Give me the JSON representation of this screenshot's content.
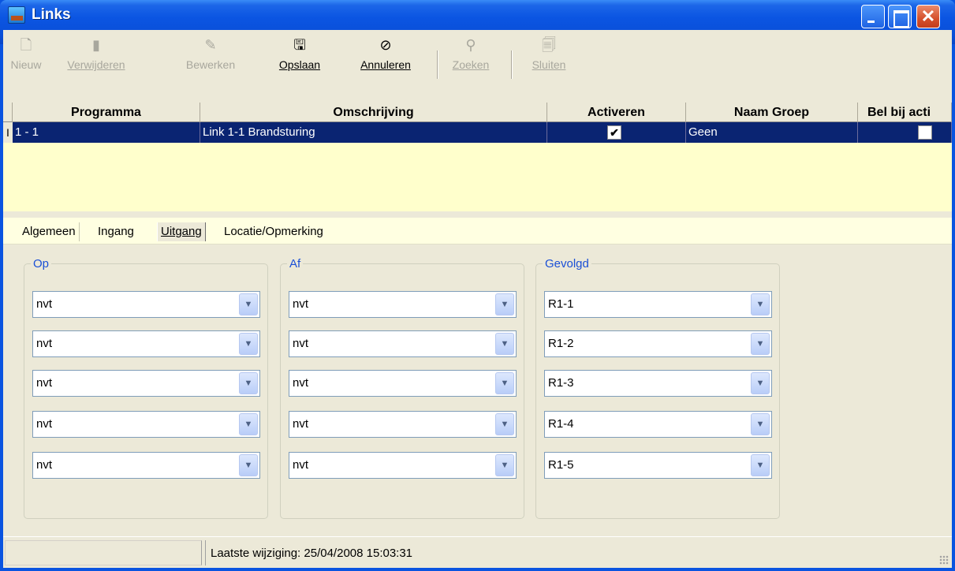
{
  "window": {
    "title": "Links"
  },
  "toolbar": {
    "buttons": [
      {
        "label": "Nieuw",
        "icon": "document-icon",
        "enabled": false
      },
      {
        "label": "Verwijderen",
        "icon": "trash-icon",
        "enabled": false
      },
      {
        "label": "Bewerken",
        "icon": "edit-icon",
        "enabled": false
      },
      {
        "label": "Opslaan",
        "icon": "save-icon",
        "enabled": true
      },
      {
        "label": "Annuleren",
        "icon": "cancel-icon",
        "enabled": true
      },
      {
        "label": "Zoeken",
        "icon": "search-icon",
        "enabled": false
      },
      {
        "label": "Sluiten",
        "icon": "close-doc-icon",
        "enabled": false
      }
    ]
  },
  "grid": {
    "columns": [
      "Programma",
      "Omschrijving",
      "Activeren",
      "Naam Groep",
      "Bel bij acti"
    ],
    "rows": [
      {
        "programma": "1 - 1",
        "omschrijving": "Link 1-1 Brandsturing",
        "activeren": true,
        "naam_groep": "Geen",
        "bel_bij_activatie": false
      }
    ],
    "row_indicator": "I"
  },
  "tabs": [
    "Algemeen",
    "Ingang",
    "Uitgang",
    "Locatie/Opmerking"
  ],
  "active_tab": "Uitgang",
  "groups": [
    {
      "label": "Op",
      "values": [
        "nvt",
        "nvt",
        "nvt",
        "nvt",
        "nvt"
      ]
    },
    {
      "label": "Af",
      "values": [
        "nvt",
        "nvt",
        "nvt",
        "nvt",
        "nvt"
      ]
    },
    {
      "label": "Gevolgd",
      "values": [
        "R1-1",
        "R1-2",
        "R1-3",
        "R1-4",
        "R1-5"
      ]
    }
  ],
  "status": {
    "text": "Laatste wijziging: 25/04/2008 15:03:31"
  },
  "colors": {
    "titlebar": "#0a54e0",
    "selected_row": "#0a2472",
    "group_label": "#1a4fd6",
    "grid_background": "#ffffcc"
  }
}
